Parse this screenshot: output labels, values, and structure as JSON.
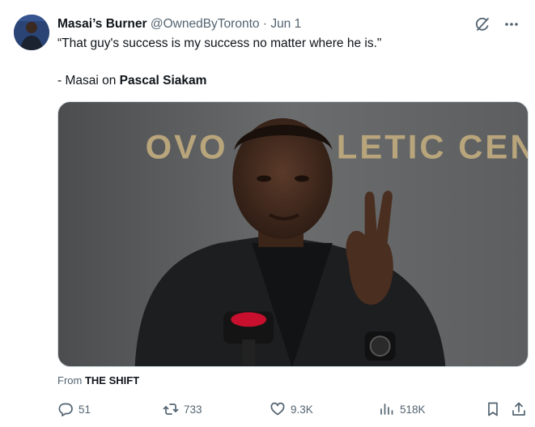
{
  "tweet": {
    "display_name": "Masai’s Burner",
    "handle": "@OwnedByToronto",
    "separator": "·",
    "date": "Jun 1",
    "text_line1": "“That guy's success is my success no matter where he is.\"",
    "text_line2_prefix": "- Masai on ",
    "text_line2_bold": "Pascal Siakam",
    "media_backdrop_text": "OVO ATHLETIC CENTR",
    "media_backdrop_text_left": "OVO",
    "media_backdrop_text_right": "LETIC CENTR",
    "from_prefix": "From",
    "from_source": "THE SHIFT"
  },
  "icons": {
    "grok": "grok-icon",
    "more": "more-icon",
    "reply": "reply-icon",
    "retweet": "retweet-icon",
    "like": "heart-icon",
    "views": "views-icon",
    "bookmark": "bookmark-icon",
    "share": "share-icon"
  },
  "actions": {
    "replies": "51",
    "retweets": "733",
    "likes": "9.3K",
    "views": "518K"
  },
  "colors": {
    "text": "#0f1419",
    "muted": "#536471",
    "border": "#cfd9de"
  }
}
